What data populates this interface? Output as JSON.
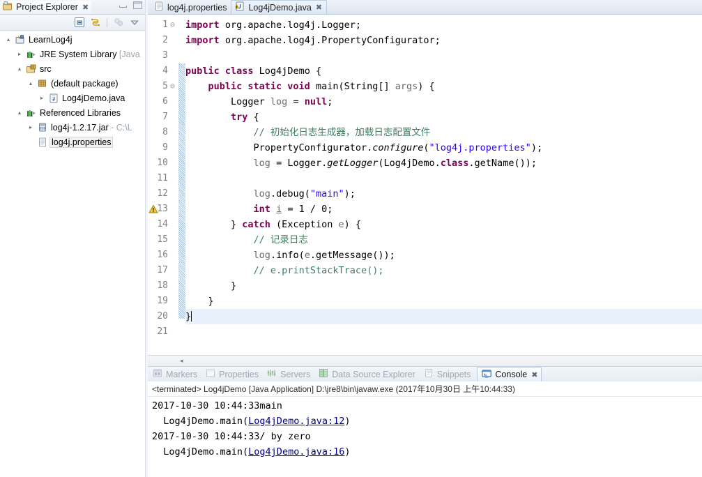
{
  "window": {
    "minimize_label": "minimize",
    "maximize_label": "maximize"
  },
  "project_explorer": {
    "tab_label": "Project Explorer",
    "tab_close": "✖",
    "toolbar": {
      "collapse_all": "collapse-all-icon",
      "link_with_editor": "link-with-editor-icon",
      "focus_on_active_task": "focus-on-active-task-icon",
      "view_menu": "view-menu-icon"
    },
    "tree": [
      {
        "label": "LearnLog4j",
        "suffix": "",
        "indent": 1,
        "arrow": "▴",
        "icon": "java-project-icon",
        "selected": false
      },
      {
        "label": "JRE System Library",
        "suffix": " [Java",
        "indent": 2,
        "arrow": "▸",
        "icon": "library-icon",
        "selected": false
      },
      {
        "label": "src",
        "suffix": "",
        "indent": 2,
        "arrow": "▴",
        "icon": "source-folder-icon",
        "selected": false
      },
      {
        "label": "(default package)",
        "suffix": "",
        "indent": 3,
        "arrow": "▴",
        "icon": "package-icon",
        "selected": false
      },
      {
        "label": "Log4jDemo.java",
        "suffix": "",
        "indent": 4,
        "arrow": "▸",
        "icon": "java-file-icon",
        "selected": false
      },
      {
        "label": "Referenced Libraries",
        "suffix": "",
        "indent": 2,
        "arrow": "▴",
        "icon": "library-icon",
        "selected": false
      },
      {
        "label": "log4j-1.2.17.jar",
        "suffix": " - C:\\L",
        "indent": 3,
        "arrow": "▸",
        "icon": "jar-icon",
        "selected": false
      },
      {
        "label": "log4j.properties",
        "suffix": "",
        "indent": 3,
        "arrow": "",
        "icon": "properties-file-icon",
        "selected": true
      }
    ]
  },
  "editor": {
    "tabs": [
      {
        "label": "log4j.properties",
        "icon": "properties-file-icon",
        "active": false,
        "close": ""
      },
      {
        "label": "Log4jDemo.java",
        "icon": "java-file-warning-icon",
        "active": true,
        "close": "✖"
      }
    ],
    "line_numbers": [
      "1",
      "2",
      "3",
      "4",
      "5",
      "6",
      "7",
      "8",
      "9",
      "10",
      "11",
      "12",
      "13",
      "14",
      "15",
      "16",
      "17",
      "18",
      "19",
      "20",
      "21"
    ],
    "fold_markers": {
      "1": "⊝",
      "5": "⊝"
    },
    "warning_line": "13",
    "caret_line": "20",
    "scroll_left_arrow": "◂",
    "lines": [
      [
        {
          "t": "import",
          "c": "kw"
        },
        {
          "t": " org.apache.log4j.Logger;",
          "c": "pl"
        }
      ],
      [
        {
          "t": "import",
          "c": "kw"
        },
        {
          "t": " org.apache.log4j.PropertyConfigurator;",
          "c": "pl"
        }
      ],
      [],
      [
        {
          "t": "public class",
          "c": "kw"
        },
        {
          "t": " Log4jDemo {",
          "c": "pl"
        }
      ],
      [
        {
          "t": "    ",
          "c": "pl"
        },
        {
          "t": "public static void",
          "c": "kw"
        },
        {
          "t": " main(String[] ",
          "c": "pl"
        },
        {
          "t": "args",
          "c": "local"
        },
        {
          "t": ") {",
          "c": "pl"
        }
      ],
      [
        {
          "t": "        Logger ",
          "c": "pl"
        },
        {
          "t": "log",
          "c": "local"
        },
        {
          "t": " = ",
          "c": "pl"
        },
        {
          "t": "null",
          "c": "kw"
        },
        {
          "t": ";",
          "c": "pl"
        }
      ],
      [
        {
          "t": "        ",
          "c": "pl"
        },
        {
          "t": "try",
          "c": "kw"
        },
        {
          "t": " {",
          "c": "pl"
        }
      ],
      [
        {
          "t": "            ",
          "c": "pl"
        },
        {
          "t": "// 初始化日志生成器，加载日志配置文件",
          "c": "cmt"
        }
      ],
      [
        {
          "t": "            PropertyConfigurator.",
          "c": "pl"
        },
        {
          "t": "configure",
          "c": "it"
        },
        {
          "t": "(",
          "c": "pl"
        },
        {
          "t": "\"log4j.properties\"",
          "c": "str"
        },
        {
          "t": ");",
          "c": "pl"
        }
      ],
      [
        {
          "t": "            ",
          "c": "pl"
        },
        {
          "t": "log",
          "c": "local"
        },
        {
          "t": " = Logger.",
          "c": "pl"
        },
        {
          "t": "getLogger",
          "c": "it"
        },
        {
          "t": "(Log4jDemo.",
          "c": "pl"
        },
        {
          "t": "class",
          "c": "kw"
        },
        {
          "t": ".getName());",
          "c": "pl"
        }
      ],
      [],
      [
        {
          "t": "            ",
          "c": "pl"
        },
        {
          "t": "log",
          "c": "local"
        },
        {
          "t": ".debug(",
          "c": "pl"
        },
        {
          "t": "\"main\"",
          "c": "str"
        },
        {
          "t": ");",
          "c": "pl"
        }
      ],
      [
        {
          "t": "            ",
          "c": "pl"
        },
        {
          "t": "int",
          "c": "kw"
        },
        {
          "t": " ",
          "c": "pl"
        },
        {
          "t": "i",
          "c": "local-u"
        },
        {
          "t": " = 1 / 0;",
          "c": "pl"
        }
      ],
      [
        {
          "t": "        } ",
          "c": "pl"
        },
        {
          "t": "catch",
          "c": "kw"
        },
        {
          "t": " (Exception ",
          "c": "pl"
        },
        {
          "t": "e",
          "c": "local"
        },
        {
          "t": ") {",
          "c": "pl"
        }
      ],
      [
        {
          "t": "            ",
          "c": "pl"
        },
        {
          "t": "// 记录日志",
          "c": "cmt"
        }
      ],
      [
        {
          "t": "            ",
          "c": "pl"
        },
        {
          "t": "log",
          "c": "local"
        },
        {
          "t": ".info(",
          "c": "pl"
        },
        {
          "t": "e",
          "c": "local"
        },
        {
          "t": ".getMessage());",
          "c": "pl"
        }
      ],
      [
        {
          "t": "            ",
          "c": "pl"
        },
        {
          "t": "// e.printStackTrace();",
          "c": "cmt"
        }
      ],
      [
        {
          "t": "        }",
          "c": "pl"
        }
      ],
      [
        {
          "t": "    }",
          "c": "pl"
        }
      ],
      [
        {
          "t": "}",
          "c": "pl"
        }
      ],
      []
    ]
  },
  "bottom_panel": {
    "tabs": [
      {
        "label": "Markers",
        "icon": "markers-icon",
        "active": false,
        "close": ""
      },
      {
        "label": "Properties",
        "icon": "properties-icon",
        "active": false,
        "close": ""
      },
      {
        "label": "Servers",
        "icon": "servers-icon",
        "active": false,
        "close": ""
      },
      {
        "label": "Data Source Explorer",
        "icon": "data-source-explorer-icon",
        "active": false,
        "close": ""
      },
      {
        "label": "Snippets",
        "icon": "snippets-icon",
        "active": false,
        "close": ""
      },
      {
        "label": "Console",
        "icon": "console-icon",
        "active": true,
        "close": "✖"
      }
    ],
    "console_header": "<terminated> Log4jDemo [Java Application] D:\\jre8\\bin\\javaw.exe (2017年10月30日 上午10:44:33)",
    "console_lines": [
      [
        {
          "t": "2017-10-30 10:44:33main",
          "c": "plain"
        }
      ],
      [
        {
          "t": "  Log4jDemo.main(",
          "c": "plain"
        },
        {
          "t": "Log4jDemo.java:12",
          "c": "link"
        },
        {
          "t": ")",
          "c": "plain"
        }
      ],
      [
        {
          "t": "2017-10-30 10:44:33/ by zero",
          "c": "plain"
        }
      ],
      [
        {
          "t": "  Log4jDemo.main(",
          "c": "plain"
        },
        {
          "t": "Log4jDemo.java:16",
          "c": "link"
        },
        {
          "t": ")",
          "c": "plain"
        }
      ]
    ]
  },
  "colors": {
    "keyword": "#7f0055",
    "string": "#2a00ff",
    "comment": "#3f7f5f",
    "link": "#00008b",
    "caret_line": "#e8f0fb",
    "change_bar": "#9dc3e6"
  }
}
